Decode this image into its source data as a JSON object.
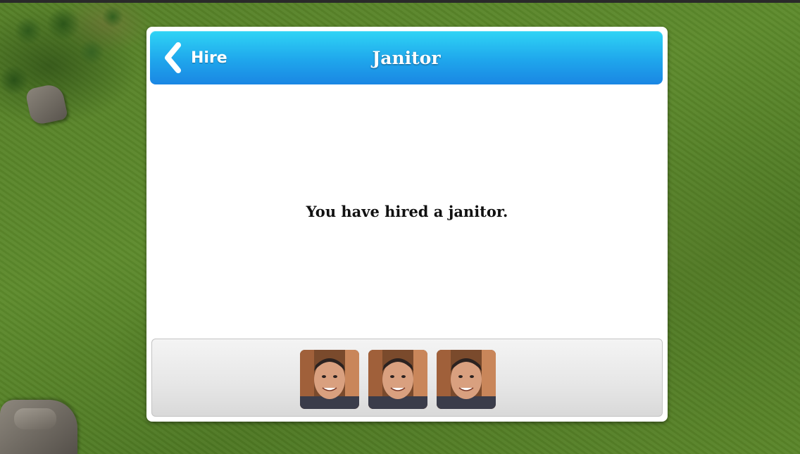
{
  "header": {
    "back_label": "Hire",
    "title": "Janitor"
  },
  "message": "You have hired a janitor.",
  "staff": {
    "portraits": [
      {
        "icon": "janitor-portrait"
      },
      {
        "icon": "janitor-portrait"
      },
      {
        "icon": "janitor-portrait"
      }
    ]
  },
  "colors": {
    "header_top": "#2fd4f5",
    "header_bottom": "#1a86e3",
    "grass": "#557f27"
  }
}
